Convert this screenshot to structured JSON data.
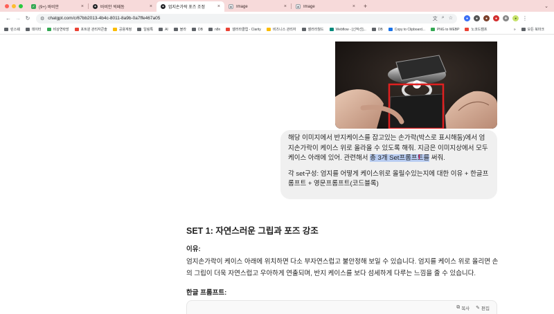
{
  "browser": {
    "tabs": [
      {
        "title": "(9+) 바비안",
        "icon_color": "#34a853",
        "active": false
      },
      {
        "title": "바비안 씩페동",
        "icon_color": "#202124",
        "active": false
      },
      {
        "title": "엄지손가락 포즈 조정",
        "icon_color": "#202124",
        "active": true
      },
      {
        "title": "Image",
        "icon_color": "#5f6368",
        "active": false
      },
      {
        "title": "Image",
        "icon_color": "#5f6368",
        "active": false
      }
    ],
    "url": "chatgpt.com/c/67bb2013-4b4c-8011-8a9b-0a7ffe467a05",
    "bookmarks": [
      {
        "label": "린스웨",
        "type": "folder"
      },
      {
        "label": "데이터",
        "type": "folder"
      },
      {
        "label": "비상연락망",
        "type": "site"
      },
      {
        "label": "포트원 관리자콘솔",
        "type": "site"
      },
      {
        "label": "공용계정",
        "type": "site"
      },
      {
        "label": "일링톡",
        "type": "folder"
      },
      {
        "label": "AI",
        "type": "folder"
      },
      {
        "label": "블라",
        "type": "site"
      },
      {
        "label": "DB",
        "type": "folder"
      },
      {
        "label": "n8n",
        "type": "folder"
      },
      {
        "label": "셀러라클럽 - Clarity",
        "type": "site"
      },
      {
        "label": "비즈니스 관리자",
        "type": "site"
      },
      {
        "label": "셀러라월드",
        "type": "folder"
      },
      {
        "label": "Webflow - [신작선]...",
        "type": "site"
      },
      {
        "label": "DB",
        "type": "site"
      },
      {
        "label": "Copy to Clipboard...",
        "type": "site"
      },
      {
        "label": "PNG to WEBP",
        "type": "site"
      },
      {
        "label": "노코드캠프",
        "type": "site"
      }
    ],
    "bookmarks_overflow": "»",
    "all_bookmarks": "모든 북마크"
  },
  "chat": {
    "user_message": {
      "line1": "해당 이미지에서 반지케이스를 잡고있는 손가락(박스로 표시해둠)에서 엄지손가락이 케이스 위로 올라올 수 있도록 해줘. 지금은 이미지상에서 모두 케이스 아래에 있어. 관련해서 ",
      "highlight": "총 3개 Set프롬프트를",
      "line1_end": " 써줘.",
      "line2": "각 set구성: 엄지를 어떻게 케이스위로 올릴수있는지에 대한 이유 + 한글프롬프트 + 영문프롬프트(코드블록)"
    },
    "response": {
      "set_heading": "SET 1: 자연스러운 그립과 포즈 강조",
      "reason_label": "이유:",
      "reason_text": "엄지손가락이 케이스 아래에 위치하면 다소 부자연스럽고 불안정해 보일 수 있습니다. 엄지를 케이스 위로 올리면 손의 그립이 더욱 자연스럽고 우아하게 연출되며, 반지 케이스를 보다 섬세하게 다루는 느낌을 줄 수 있습니다.",
      "korean_prompt_label": "한글 프롬프트:",
      "copy_label": "복사",
      "edit_label": "편집"
    }
  },
  "colors": {
    "tabstrip": "#f7dada",
    "highlight": "#b9cdf2",
    "bubble": "#f0f0f0",
    "selection_box": "#e02020"
  }
}
